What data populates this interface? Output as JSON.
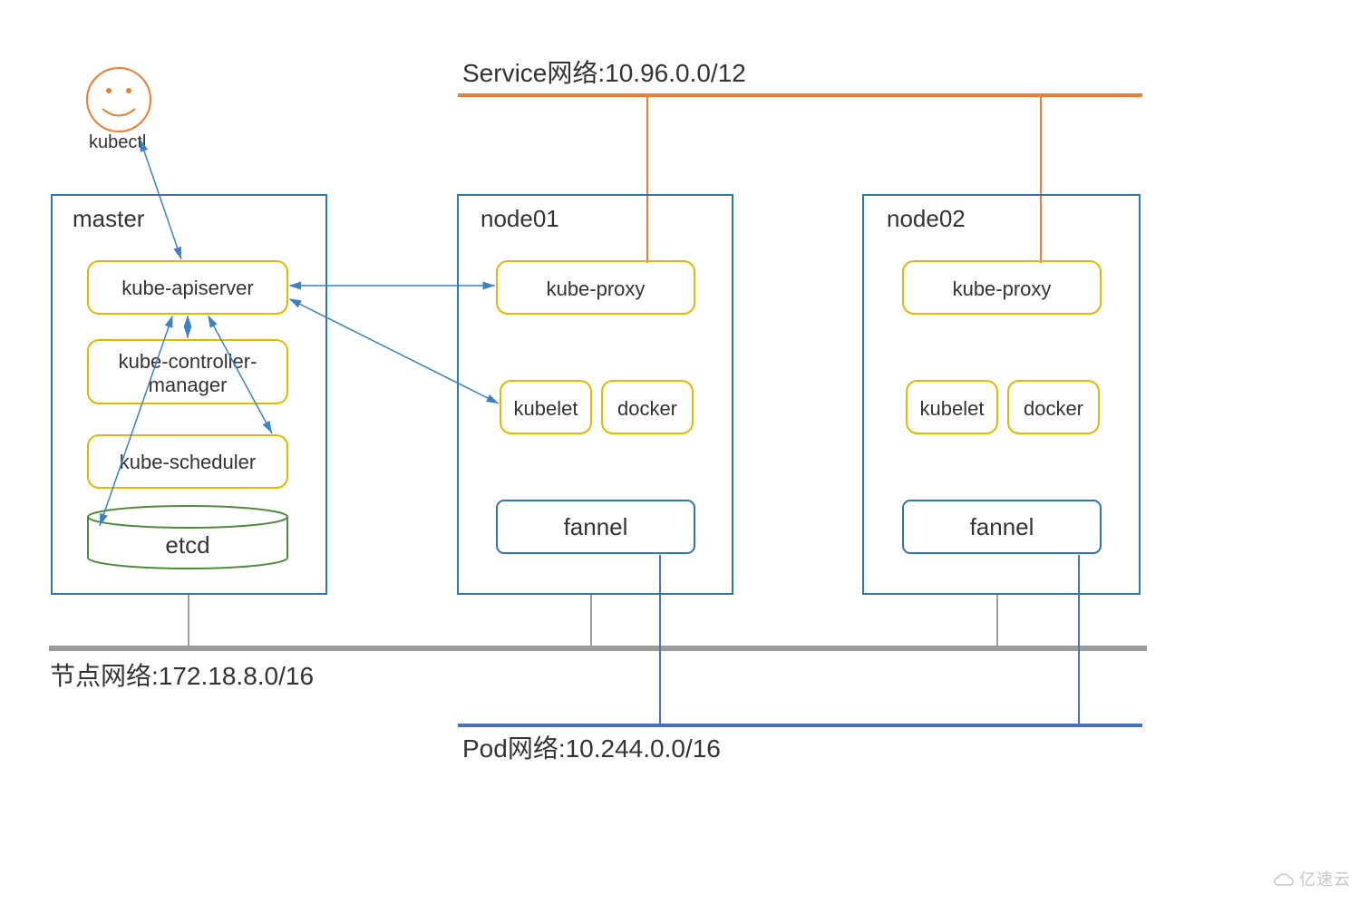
{
  "client": {
    "label": "kubectl"
  },
  "networks": {
    "service": "Service网络:10.96.0.0/12",
    "node": "节点网络:172.18.8.0/16",
    "pod": "Pod网络:10.244.0.0/16"
  },
  "master": {
    "title": "master",
    "components": {
      "apiserver": "kube-apiserver",
      "controller": "kube-controller-manager",
      "scheduler": "kube-scheduler",
      "etcd": "etcd"
    }
  },
  "node01": {
    "title": "node01",
    "components": {
      "proxy": "kube-proxy",
      "kubelet": "kubelet",
      "docker": "docker",
      "fannel": "fannel"
    }
  },
  "node02": {
    "title": "node02",
    "components": {
      "proxy": "kube-proxy",
      "kubelet": "kubelet",
      "docker": "docker",
      "fannel": "fannel"
    }
  },
  "watermark": "亿速云"
}
